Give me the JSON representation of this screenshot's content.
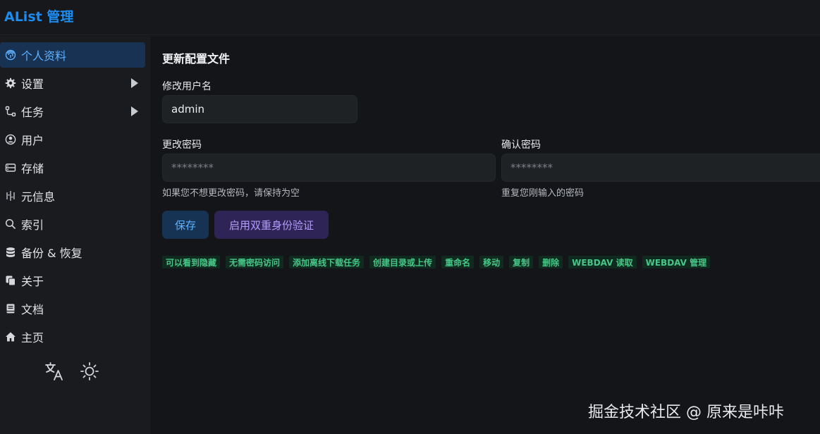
{
  "app": {
    "title": "AList 管理"
  },
  "sidebar": {
    "items": [
      {
        "label": "个人资料",
        "icon": "fingerprint-icon",
        "active": true
      },
      {
        "label": "设置",
        "icon": "gear-icon",
        "expandable": true
      },
      {
        "label": "任务",
        "icon": "tasks-icon",
        "expandable": true
      },
      {
        "label": "用户",
        "icon": "user-circle-icon"
      },
      {
        "label": "存储",
        "icon": "storage-icon"
      },
      {
        "label": "元信息",
        "icon": "meta-icon"
      },
      {
        "label": "索引",
        "icon": "search-icon"
      },
      {
        "label": "备份 & 恢复",
        "icon": "database-icon"
      },
      {
        "label": "关于",
        "icon": "copy-icon"
      },
      {
        "label": "文档",
        "icon": "book-icon"
      },
      {
        "label": "主页",
        "icon": "home-icon"
      }
    ],
    "tools": [
      "translate-icon",
      "sun-icon"
    ]
  },
  "main": {
    "title": "更新配置文件",
    "username": {
      "label": "修改用户名",
      "value": "admin"
    },
    "password": {
      "label": "更改密码",
      "placeholder": "********",
      "helper": "如果您不想更改密码，请保持为空"
    },
    "confirm": {
      "label": "确认密码",
      "placeholder": "********",
      "helper": "重复您刚输入的密码"
    },
    "save_label": "保存",
    "enable_2fa_label": "启用双重身份验证",
    "permissions": [
      "可以看到隐藏",
      "无需密码访问",
      "添加离线下载任务",
      "创建目录或上传",
      "重命名",
      "移动",
      "复制",
      "删除",
      "WEBDAV 读取",
      "WEBDAV 管理"
    ]
  },
  "watermark": "掘金技术社区 @ 原来是咔咔",
  "colors": {
    "accent": "#1d8cf0",
    "active_bg": "#173252",
    "permission_fg": "#46c787",
    "twofa_bg": "#2e2456"
  }
}
